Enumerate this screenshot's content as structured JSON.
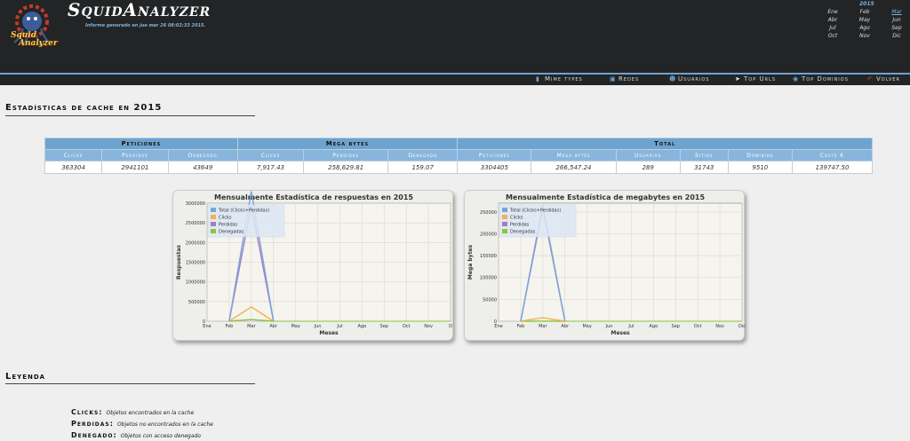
{
  "header": {
    "brand": "SquidAnalyzer",
    "logo_text_1": "Squid",
    "logo_text_2": "Analyzer",
    "subtitle": "Informe generado en jue mar 26 08:02:33 2015.",
    "calendar": {
      "year": "2015",
      "months": [
        {
          "label": "Ene",
          "link": false
        },
        {
          "label": "Feb",
          "link": false
        },
        {
          "label": "Mar",
          "link": true
        },
        {
          "label": "Abr",
          "link": false
        },
        {
          "label": "May",
          "link": false
        },
        {
          "label": "Jun",
          "link": false
        },
        {
          "label": "Jul",
          "link": false
        },
        {
          "label": "Ago",
          "link": false
        },
        {
          "label": "Sep",
          "link": false
        },
        {
          "label": "Oct",
          "link": false
        },
        {
          "label": "Nov",
          "link": false
        },
        {
          "label": "Dic",
          "link": false
        }
      ]
    }
  },
  "menu": {
    "items": [
      {
        "label": "Mime types",
        "icon": "file-icon",
        "glyph": "▮"
      },
      {
        "label": "Redes",
        "icon": "network-icon",
        "glyph": "▣"
      },
      {
        "label": "Usuarios",
        "icon": "user-icon",
        "glyph": "☻"
      },
      {
        "label": "Top Urls",
        "icon": "cursor-icon",
        "glyph": "➤"
      },
      {
        "label": "Top Dominios",
        "icon": "globe-icon",
        "glyph": "◉"
      },
      {
        "label": "Volver",
        "icon": "back-arrow-icon",
        "glyph": "↶"
      }
    ]
  },
  "cache_section": {
    "title": "Estadísticas de cache en 2015"
  },
  "stats_table": {
    "groups": [
      "Peticiones",
      "Mega bytes",
      "Total"
    ],
    "columns": [
      "Clicks",
      "Perdidas",
      "Denegado",
      "Clicks",
      "Perdidas",
      "Denegado",
      "Peticiones",
      "Mega bytes",
      "Usuarios",
      "Sitios",
      "Dominios",
      "Coste €"
    ],
    "values": [
      "363304",
      "2941101",
      "43649",
      "7,917.43",
      "258,629.81",
      "159.07",
      "3304405",
      "266,547.24",
      "289",
      "31743",
      "9510",
      "139747.50"
    ]
  },
  "charts": {
    "legend_labels": [
      "Total (Clicks+Perdidas)",
      "Clicks",
      "Perdidas",
      "Denegadas"
    ],
    "colors": {
      "total": "#7aa5d8",
      "clicks": "#f2b24e",
      "perdidas": "#a37cc7",
      "denegadas": "#8cc43f"
    },
    "x_axis_title": "Meses"
  },
  "chart_data": [
    {
      "type": "line",
      "title": "Mensualmente Estadística de respuestas en 2015",
      "xlabel": "Meses",
      "ylabel": "Respuestas",
      "categories": [
        "Ene",
        "Feb",
        "Mar",
        "Abr",
        "May",
        "Jun",
        "Jul",
        "Ago",
        "Sep",
        "Oct",
        "Nov",
        "D"
      ],
      "ylim": [
        0,
        3000000
      ],
      "yticks": [
        "0",
        "500000",
        "1000000",
        "1500000",
        "2000000",
        "2500000",
        "3000000"
      ],
      "legend": "top-left",
      "grid": true,
      "series": [
        {
          "name": "Total (Clicks+Perdidas)",
          "values": [
            0,
            0,
            3304405,
            0,
            0,
            0,
            0,
            0,
            0,
            0,
            0,
            0
          ]
        },
        {
          "name": "Clicks",
          "values": [
            0,
            0,
            363304,
            0,
            0,
            0,
            0,
            0,
            0,
            0,
            0,
            0
          ]
        },
        {
          "name": "Perdidas",
          "values": [
            0,
            0,
            2941101,
            0,
            0,
            0,
            0,
            0,
            0,
            0,
            0,
            0
          ]
        },
        {
          "name": "Denegadas",
          "values": [
            0,
            0,
            43649,
            0,
            0,
            0,
            0,
            0,
            0,
            0,
            0,
            0
          ]
        }
      ]
    },
    {
      "type": "line",
      "title": "Mensualmente Estadística de megabytes en 2015",
      "xlabel": "Meses",
      "ylabel": "Mega bytes",
      "categories": [
        "Ene",
        "Feb",
        "Mar",
        "Abr",
        "May",
        "Jun",
        "Jul",
        "Ago",
        "Sep",
        "Oct",
        "Nov",
        "Dic"
      ],
      "ylim": [
        0,
        270000
      ],
      "yticks": [
        "0",
        "50000",
        "100000",
        "150000",
        "200000",
        "250000"
      ],
      "legend": "top-left",
      "grid": true,
      "series": [
        {
          "name": "Total (Clicks+Perdidas)",
          "values": [
            0,
            0,
            266547,
            0,
            0,
            0,
            0,
            0,
            0,
            0,
            0,
            0
          ]
        },
        {
          "name": "Clicks",
          "values": [
            0,
            0,
            7917,
            0,
            0,
            0,
            0,
            0,
            0,
            0,
            0,
            0
          ]
        },
        {
          "name": "Perdidas",
          "values": [
            0,
            0,
            258630,
            0,
            0,
            0,
            0,
            0,
            0,
            0,
            0,
            0
          ]
        },
        {
          "name": "Denegadas",
          "values": [
            0,
            0,
            159,
            0,
            0,
            0,
            0,
            0,
            0,
            0,
            0,
            0
          ]
        }
      ]
    }
  ],
  "legend_section": {
    "title": "Leyenda",
    "items": [
      {
        "key": "Clicks:",
        "desc": "Objetos encontrados en la cache"
      },
      {
        "key": "Perdidas:",
        "desc": "Objetos no encontrados en la cache"
      },
      {
        "key": "Denegado:",
        "desc": "Objetos con acceso denegado"
      }
    ]
  }
}
